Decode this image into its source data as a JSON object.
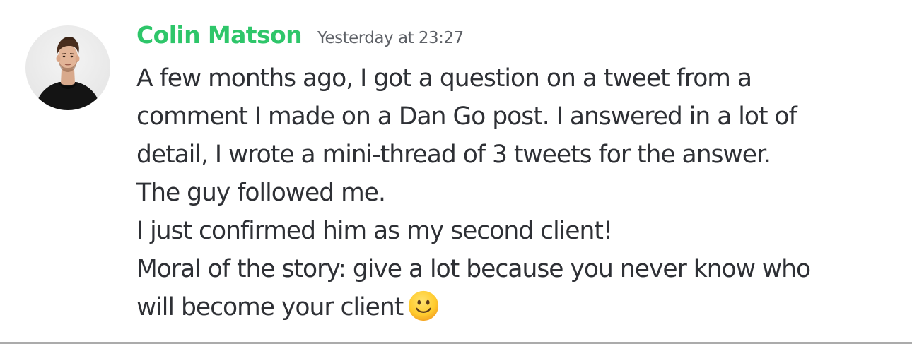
{
  "message": {
    "author": "Colin Matson",
    "timestamp": "Yesterday at 23:27",
    "avatar_icon": "user-avatar-photo",
    "lines": [
      "A few months ago, I got a question on a tweet from a",
      "comment I made on a Dan Go post. I answered in a lot of",
      "detail, I wrote a mini-thread of 3 tweets for the answer.",
      "The guy followed me.",
      "I just confirmed him as my second client!",
      "Moral of the story: give a lot because you never know who",
      "will become your client"
    ],
    "trailing_emoji": "slightly-smiling-face-icon"
  },
  "colors": {
    "author": "#2ec66a",
    "timestamp": "#5e6167",
    "text": "#2e3035",
    "background": "#ffffff",
    "divider": "#ababab"
  }
}
